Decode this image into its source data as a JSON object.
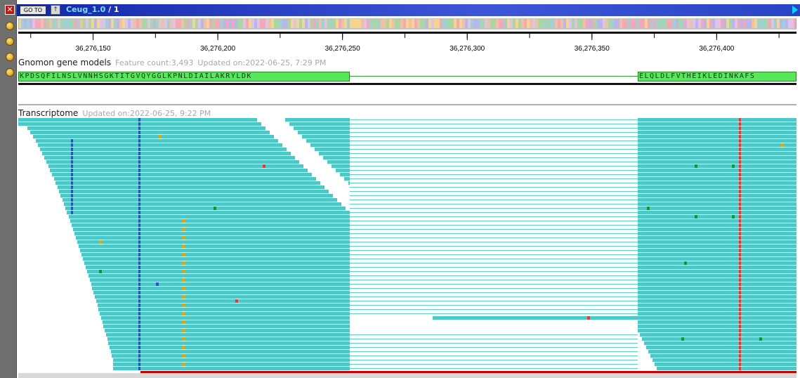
{
  "window": {
    "goto_label": "GO TO",
    "up_icon": "↑",
    "close_icon": "✕",
    "sequence_name": "Ceug_1.0",
    "sequence_suffix": "/ 1"
  },
  "ruler": {
    "start": 36276120,
    "end": 36276432,
    "ticks": [
      {
        "label": "36,276,150",
        "pos": 36276150
      },
      {
        "label": "36,276,200",
        "pos": 36276200
      },
      {
        "label": "36,276,250",
        "pos": 36276250
      },
      {
        "label": "36,276,300",
        "pos": 36276300
      },
      {
        "label": "36,276,350",
        "pos": 36276350
      },
      {
        "label": "36,276,400",
        "pos": 36276400
      }
    ]
  },
  "tracks": {
    "gnomon": {
      "title": "Gnomon gene models",
      "feature_count": "Feature count:3,493",
      "updated": "Updated on:2022-06-25, 7:29 PM",
      "protein_left": "KPDSQFILNSLVNNHSGKTITGVQYGGLKPNLDIAILAKRYLDK",
      "protein_right": "ELQLDLFVTHEIKLEDINKAFS"
    },
    "transcriptome": {
      "title": "Transcriptome",
      "updated": "Updated on:2022-06-25, 9:22 PM"
    }
  },
  "colors": {
    "read": "#4bc8c8",
    "read_edge": "#2ea3a3",
    "intron": "#5ccfcf",
    "protein": "#57e65c",
    "mismatch_blue": "#3348e0",
    "mismatch_orange": "#f2a200",
    "mismatch_red": "#e33b3b",
    "mismatch_green": "#0f9a2a",
    "accent_bar": "#cc0000"
  }
}
